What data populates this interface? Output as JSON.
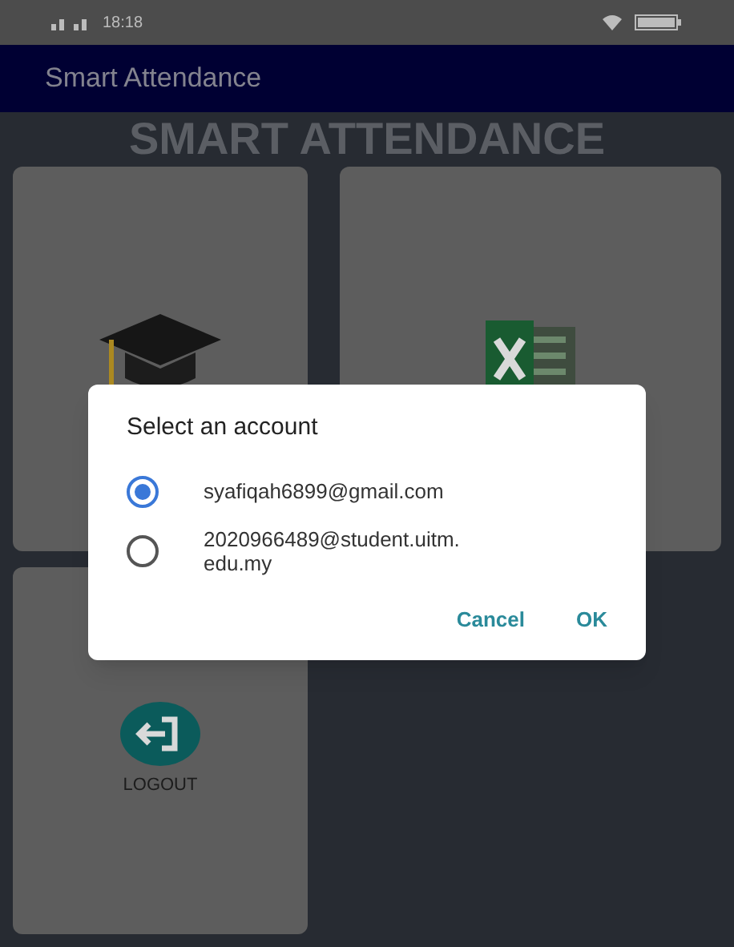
{
  "status_bar": {
    "time": "18:18"
  },
  "app_bar": {
    "title": "Smart Attendance"
  },
  "heading": "SMART ATTENDANCE",
  "cards": [
    {
      "kind": "cap"
    },
    {
      "kind": "sheet"
    },
    {
      "kind": "logout",
      "label": "LOGOUT"
    }
  ],
  "dialog": {
    "title": "Select an account",
    "accounts": [
      {
        "email": "syafiqah6899@gmail.com",
        "selected": true
      },
      {
        "email": "2020966489@student.uitm.edu.my",
        "selected": false
      }
    ],
    "buttons": [
      "Cancel",
      "OK"
    ]
  }
}
